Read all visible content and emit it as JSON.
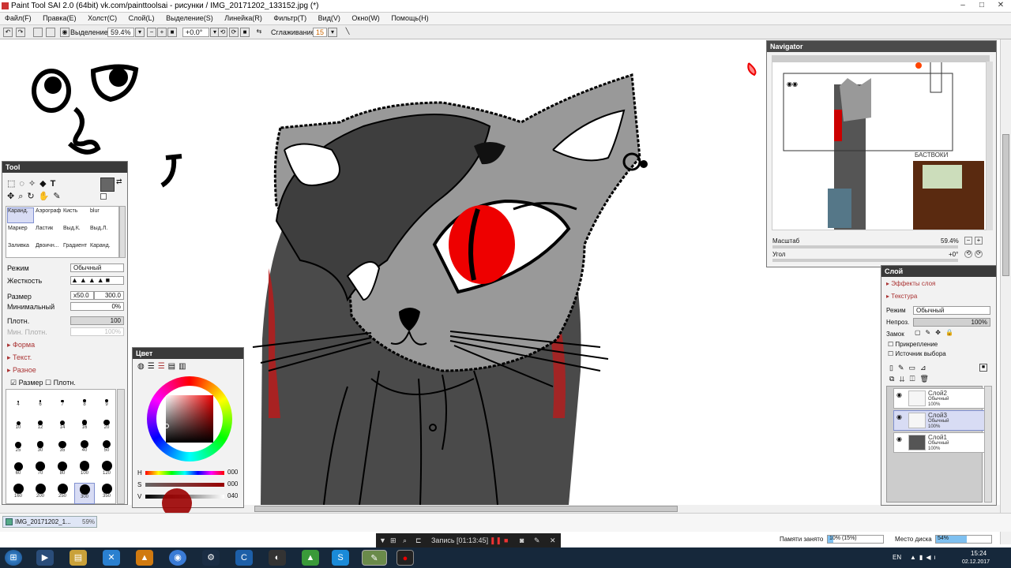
{
  "window": {
    "title": "Paint Tool SAI 2.0 (64bit) vk.com/painttoolsai - рисунки / IMG_20171202_133152.jpg (*)"
  },
  "menu": [
    "Файл(F)",
    "Правка(E)",
    "Холст(C)",
    "Слой(L)",
    "Выделение(S)",
    "Линейка(R)",
    "Фильтр(T)",
    "Вид(V)",
    "Окно(W)",
    "Помощь(H)"
  ],
  "toolbar": {
    "selection_label": "Выделение",
    "zoom": "59.4%",
    "angle": "+0.0°",
    "smoothing_label": "Сглаживание",
    "smoothing_value": "15"
  },
  "tool_panel": {
    "title": "Tool",
    "brushes": [
      [
        "Каранд.",
        "Аэрограф",
        "Кисть",
        "blur"
      ],
      [
        "Маркер",
        "Ластик",
        "Выд.К.",
        "Выд.Л."
      ],
      [
        "Заливка",
        "Двоичн...",
        "Градиент",
        "Каранд."
      ]
    ],
    "mode_label": "Режим",
    "mode_value": "Обычный",
    "hardness_label": "Жесткость",
    "size_label": "Размер",
    "size_multiplier": "x50.0",
    "size_value": "300.0",
    "min_label": "Минимальный",
    "min_value": "0%",
    "density_label": "Плотн.",
    "density_value": "100",
    "min_density_label": "Мин. Плотн.",
    "min_density_value": "100%",
    "sections": [
      "Форма",
      "Текст.",
      "Разное"
    ],
    "check_size": "Размер",
    "check_density": "Плотн.",
    "sizes": [
      "4",
      "6",
      "7",
      "8",
      "9",
      "10",
      "12",
      "14",
      "16",
      "20",
      "25",
      "30",
      "35",
      "40",
      "50",
      "60",
      "70",
      "80",
      "100",
      "120",
      "160",
      "200",
      "250",
      "300",
      "350"
    ]
  },
  "color_panel": {
    "title": "Цвет",
    "h_label": "H",
    "h_value": "000",
    "s_label": "S",
    "s_value": "000",
    "v_label": "V",
    "v_value": "040"
  },
  "navigator": {
    "title": "Navigator",
    "scale_label": "Масштаб",
    "scale_value": "59.4%",
    "angle_label": "Угол",
    "angle_value": "+0°"
  },
  "layer_panel": {
    "title": "Слой",
    "effects_label": "Эффекты слоя",
    "texture_label": "Текстура",
    "mode_label": "Режим",
    "mode_value": "Обычный",
    "opacity_label": "Непроз.",
    "opacity_value": "100%",
    "lock_label": "Замок",
    "clip_label": "Прикрепление",
    "source_label": "Источник выбора",
    "layers": [
      {
        "name": "Слой2",
        "mode": "Обычный",
        "opacity": "100%"
      },
      {
        "name": "Слой3",
        "mode": "Обычный",
        "opacity": "100%"
      },
      {
        "name": "Слой1",
        "mode": "Обычный",
        "opacity": "100%"
      }
    ]
  },
  "document_tab": {
    "name": "IMG_20171202_1...",
    "zoom": "59%"
  },
  "recorder": {
    "label": "Запись [01:13:45]"
  },
  "status": {
    "memory_label": "Памяти занято",
    "memory_value": "10% (15%)",
    "disk_label": "Место диска",
    "disk_value": "54%"
  },
  "taskbar": {
    "lang": "EN",
    "time": "15:24",
    "date": "02.12.2017"
  },
  "colors": {
    "accent_red": "#e00000",
    "panel_header": "#3a3a3a",
    "selection_blue": "#d8dcf4",
    "taskbar": "#16283b"
  }
}
